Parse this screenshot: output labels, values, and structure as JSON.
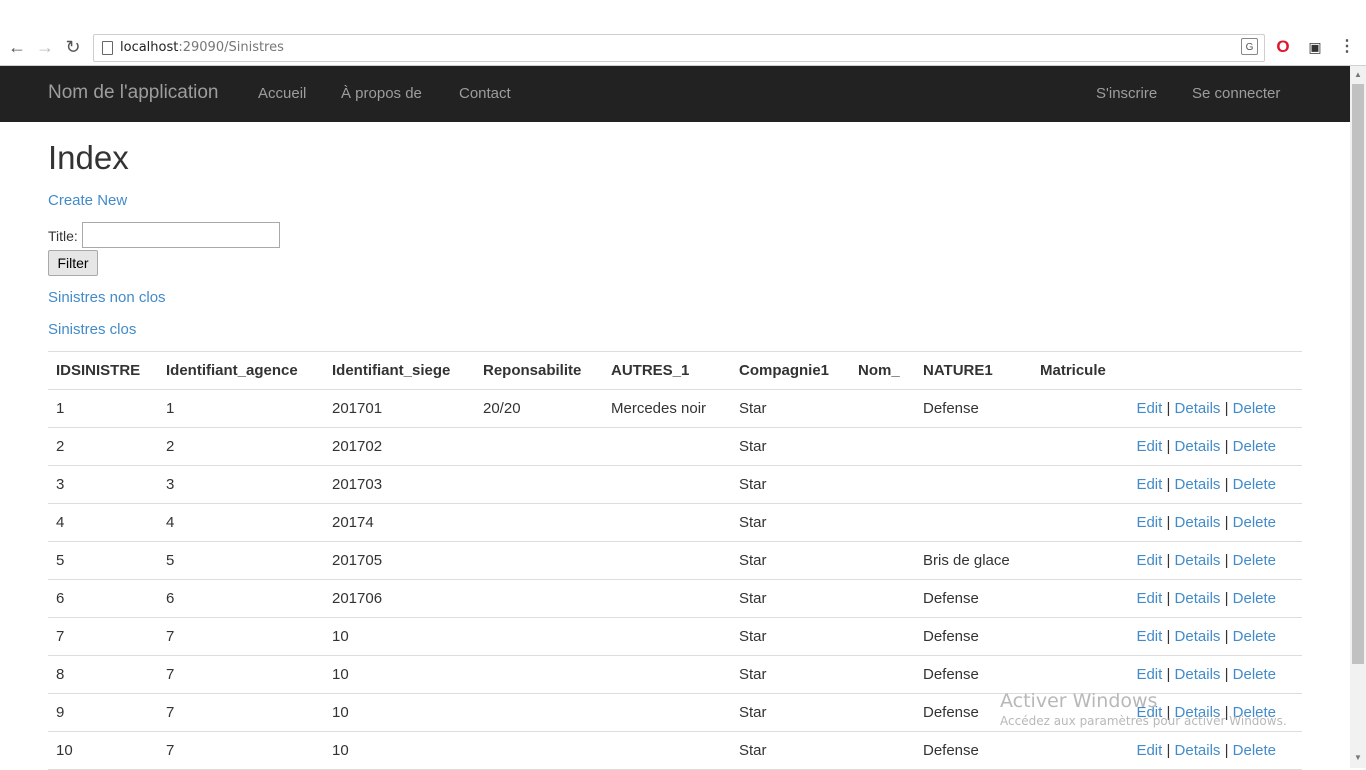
{
  "browser": {
    "url_host": "localhost",
    "url_path": ":29090/Sinistres",
    "translate_icon_text": "G"
  },
  "navbar": {
    "brand": "Nom de l'application",
    "links": [
      "Accueil",
      "À propos de",
      "Contact"
    ],
    "right_links": [
      "S'inscrire",
      "Se connecter"
    ]
  },
  "page": {
    "title": "Index",
    "create_new": "Create New",
    "filter_label": "Title:",
    "filter_value": "",
    "filter_button": "Filter",
    "link_non_clos": "Sinistres non clos",
    "link_clos": "Sinistres clos"
  },
  "table": {
    "columns": [
      "IDSINISTRE",
      "Identifiant_agence",
      "Identifiant_siege",
      "Reponsabilite",
      "AUTRES_1",
      "Compagnie1",
      "Nom_",
      "NATURE1",
      "Matricule"
    ],
    "actions": [
      "Edit",
      "Details",
      "Delete"
    ],
    "rows": [
      [
        "1",
        "1",
        "201701",
        "20/20",
        "Mercedes noir",
        "Star",
        "",
        "Defense",
        ""
      ],
      [
        "2",
        "2",
        "201702",
        "",
        "",
        "Star",
        "",
        "",
        ""
      ],
      [
        "3",
        "3",
        "201703",
        "",
        "",
        "Star",
        "",
        "",
        ""
      ],
      [
        "4",
        "4",
        "20174",
        "",
        "",
        "Star",
        "",
        "",
        ""
      ],
      [
        "5",
        "5",
        "201705",
        "",
        "",
        "Star",
        "",
        "Bris de glace",
        ""
      ],
      [
        "6",
        "6",
        "201706",
        "",
        "",
        "Star",
        "",
        "Defense",
        ""
      ],
      [
        "7",
        "7",
        "10",
        "",
        "",
        "Star",
        "",
        "Defense",
        ""
      ],
      [
        "8",
        "7",
        "10",
        "",
        "",
        "Star",
        "",
        "Defense",
        ""
      ],
      [
        "9",
        "7",
        "10",
        "",
        "",
        "Star",
        "",
        "Defense",
        ""
      ],
      [
        "10",
        "7",
        "10",
        "",
        "",
        "Star",
        "",
        "Defense",
        ""
      ]
    ]
  },
  "watermark": {
    "title": "Activer Windows",
    "subtitle": "Accédez aux paramètres pour activer Windows."
  }
}
